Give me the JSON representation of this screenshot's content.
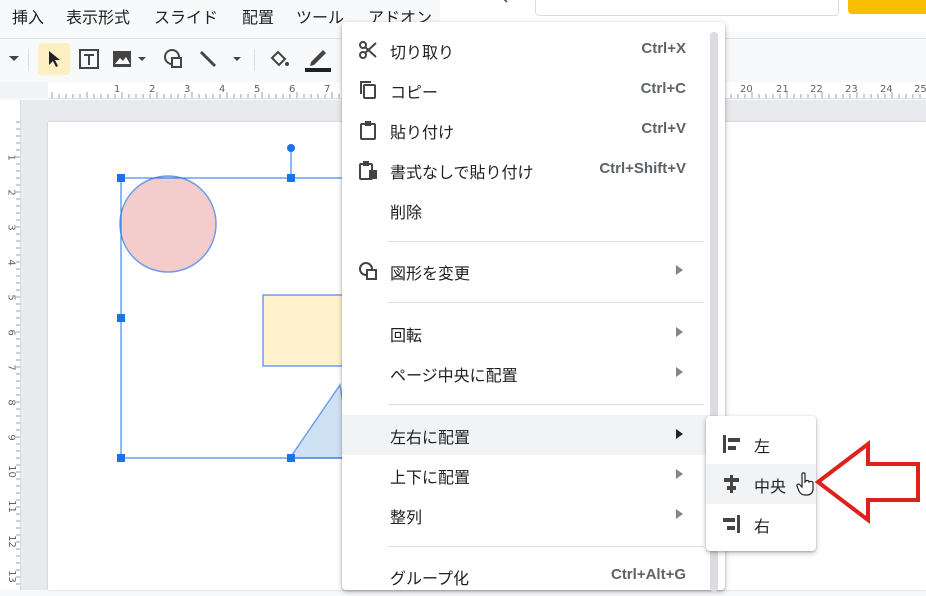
{
  "menubar": {
    "items": [
      "挿入",
      "表示形式",
      "スライド",
      "配置",
      "ツール",
      "アドオン"
    ]
  },
  "toolbar": {
    "icons": [
      "chevron-down-icon",
      "select-cursor-icon",
      "text-box-icon",
      "image-icon",
      "shape-icon",
      "line-icon",
      "fill-color-icon",
      "border-color-icon"
    ]
  },
  "ruler": {
    "h_ticks": [
      "1",
      "2",
      "3",
      "4",
      "5",
      "6",
      "7",
      "8",
      "9",
      "20",
      "21",
      "22",
      "23",
      "24",
      "25"
    ],
    "v_ticks": [
      "1",
      "2",
      "3",
      "4",
      "5",
      "6",
      "7",
      "8",
      "9",
      "10",
      "11",
      "12",
      "13"
    ]
  },
  "context_menu": {
    "items": [
      {
        "label": "切り取り",
        "shortcut": "Ctrl+X",
        "icon": "scissors-icon"
      },
      {
        "label": "コピー",
        "shortcut": "Ctrl+C",
        "icon": "copy-icon"
      },
      {
        "label": "貼り付け",
        "shortcut": "Ctrl+V",
        "icon": "clipboard-icon"
      },
      {
        "label": "書式なしで貼り付け",
        "shortcut": "Ctrl+Shift+V",
        "icon": "paste-plain-icon"
      },
      {
        "label": "削除",
        "shortcut": "",
        "icon": ""
      },
      {
        "label": "図形を変更",
        "shortcut": "",
        "icon": "shape-change-icon"
      },
      {
        "label": "回転",
        "shortcut": "",
        "icon": ""
      },
      {
        "label": "ページ中央に配置",
        "shortcut": "",
        "icon": ""
      },
      {
        "label": "左右に配置",
        "shortcut": "",
        "icon": ""
      },
      {
        "label": "上下に配置",
        "shortcut": "",
        "icon": ""
      },
      {
        "label": "整列",
        "shortcut": "",
        "icon": ""
      },
      {
        "label": "グループ化",
        "shortcut": "Ctrl+Alt+G",
        "icon": ""
      }
    ]
  },
  "submenu": {
    "items": [
      {
        "label": "左",
        "icon": "align-left-icon"
      },
      {
        "label": "中央",
        "icon": "align-center-icon"
      },
      {
        "label": "右",
        "icon": "align-right-icon"
      }
    ]
  },
  "colors": {
    "accent": "#1a73e8",
    "highlight": "#f1f3f4",
    "annotation_arrow": "#e0201b",
    "circle_fill": "#f4cccc",
    "rect_fill": "#fff2cc",
    "triangle_fill": "#cfe2f3"
  }
}
